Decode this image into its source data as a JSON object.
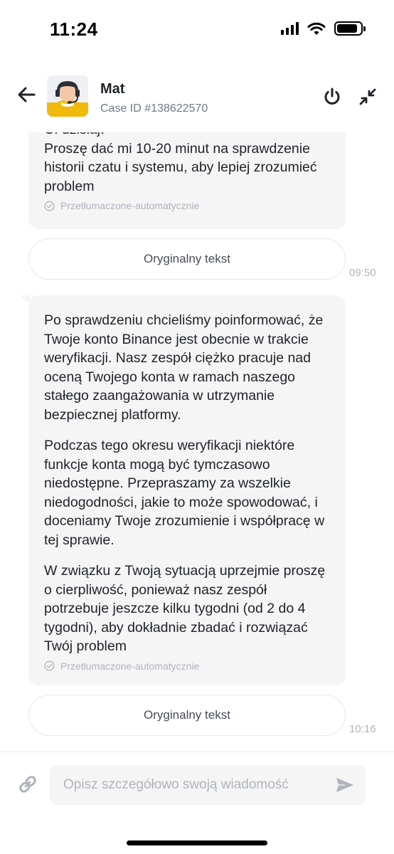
{
  "status_bar": {
    "time": "11:24"
  },
  "header": {
    "agent_name": "Mat",
    "case_id": "Case ID #138622570"
  },
  "messages": [
    {
      "paragraphs": [
        "Cí dzisiaj.",
        "Proszę dać mi 10-20 minut na sprawdzenie historii czatu i systemu, aby lepiej zrozumieć problem"
      ],
      "auto_translated_label": "Przetłumaczone-automatycznie",
      "original_text_button": "Oryginalny tekst",
      "time": "09:50"
    },
    {
      "paragraphs": [
        " Po sprawdzeniu chcieliśmy poinformować, że Twoje konto Binance jest obecnie w trakcie weryfikacji. Nasz zespół ciężko pracuje nad oceną Twojego konta w ramach naszego stałego zaangażowania w utrzymanie bezpiecznej platformy.",
        "Podczas tego okresu weryfikacji niektóre funkcje konta mogą być tymczasowo niedostępne. Przepraszamy za wszelkie niedogodności, jakie to może spowodować, i doceniamy Twoje zrozumienie i współpracę w tej sprawie.",
        "W związku z Twoją sytuacją uprzejmie proszę o cierpliwość, ponieważ nasz zespół potrzebuje jeszcze kilku tygodni (od 2 do 4 tygodni), aby dokładnie zbadać i rozwiązać Twój problem"
      ],
      "auto_translated_label": "Przetłumaczone-automatycznie",
      "original_text_button": "Oryginalny tekst",
      "time": "10:16"
    }
  ],
  "composer": {
    "placeholder": "Opisz szczegółowo swoją wiadomość"
  },
  "icons": {
    "back": "arrow-left-icon",
    "power": "power-icon",
    "minimize": "minimize-icon",
    "attach": "link-icon",
    "send": "send-icon",
    "check": "check-circle-icon"
  },
  "colors": {
    "bubble_bg": "#f5f5f5",
    "text_primary": "#1e2329",
    "text_secondary": "#707a8a",
    "text_muted": "#aeb4bc",
    "avatar_accent": "#f0b90b"
  }
}
